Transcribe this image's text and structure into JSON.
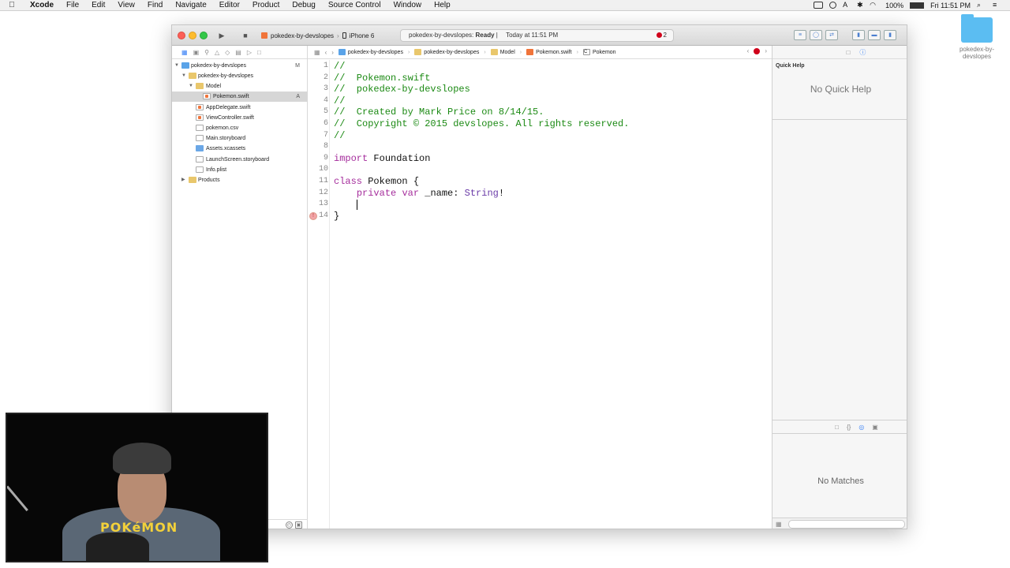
{
  "menubar": {
    "app_name": "Xcode",
    "items": [
      "File",
      "Edit",
      "View",
      "Find",
      "Navigate",
      "Editor",
      "Product",
      "Debug",
      "Source Control",
      "Window",
      "Help"
    ],
    "battery": "100%",
    "clock": "Fri 11:51 PM"
  },
  "desktop": {
    "folder_label": "pokedex-by-devslopes"
  },
  "toolbar": {
    "scheme": "pokedex-by-devslopes",
    "device": "iPhone 6",
    "status_project": "pokedex-by-devslopes:",
    "status_state": "Ready",
    "status_time": "Today at 11:51 PM",
    "error_count": "2"
  },
  "navigator": {
    "items": [
      {
        "label": "pokedex-by-devslopes",
        "badge": "M"
      },
      {
        "label": "pokedex-by-devslopes"
      },
      {
        "label": "Model"
      },
      {
        "label": "Pokemon.swift",
        "badge": "A"
      },
      {
        "label": "AppDelegate.swift"
      },
      {
        "label": "ViewController.swift"
      },
      {
        "label": "pokemon.csv"
      },
      {
        "label": "Main.storyboard"
      },
      {
        "label": "Assets.xcassets"
      },
      {
        "label": "LaunchScreen.storyboard"
      },
      {
        "label": "Info.plist"
      },
      {
        "label": "Products"
      }
    ]
  },
  "jumpbar": {
    "crumbs": [
      "pokedex-by-devslopes",
      "pokedex-by-devslopes",
      "Model",
      "Pokemon.swift",
      "Pokemon"
    ]
  },
  "code": {
    "line_numbers": [
      "1",
      "2",
      "3",
      "4",
      "5",
      "6",
      "7",
      "8",
      "9",
      "10",
      "11",
      "12",
      "13",
      "14"
    ],
    "l1": "//",
    "l2": "//  Pokemon.swift",
    "l3": "//  pokedex-by-devslopes",
    "l4": "//",
    "l5": "//  Created by Mark Price on 8/14/15.",
    "l6": "//  Copyright © 2015 devslopes. All rights reserved.",
    "l7": "//",
    "l9_kw": "import",
    "l9_rest": " Foundation",
    "l11_kw": "class",
    "l11_rest": " Pokemon {",
    "l12_indent": "    ",
    "l12_kw1": "private",
    "l12_sp": " ",
    "l12_kw2": "var",
    "l12_mid": " _name: ",
    "l12_type": "String",
    "l12_end": "!",
    "l14": "}"
  },
  "inspector": {
    "quick_help_title": "Quick Help",
    "quick_help_empty": "No Quick Help",
    "library_empty": "No Matches"
  }
}
